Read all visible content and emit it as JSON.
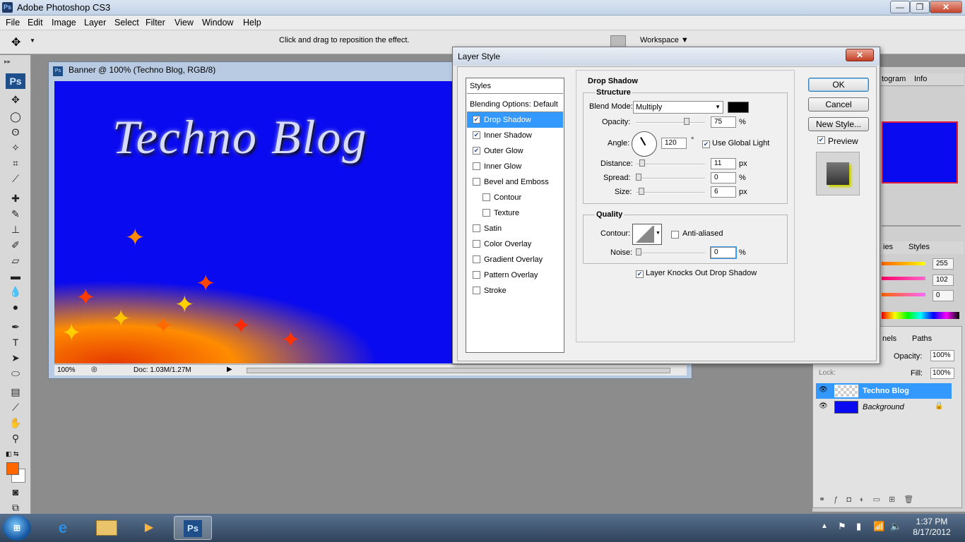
{
  "app": {
    "title": "Adobe Photoshop CS3",
    "window_controls": [
      "minimize-icon",
      "restore-icon",
      "close-icon"
    ]
  },
  "menu": [
    "File",
    "Edit",
    "Image",
    "Layer",
    "Select",
    "Filter",
    "View",
    "Window",
    "Help"
  ],
  "options_bar": {
    "hint": "Click and drag to reposition the effect.",
    "workspace": "Workspace"
  },
  "document": {
    "title": "Banner @ 100% (Techno Blog, RGB/8)",
    "canvas_text": "Techno Blog",
    "zoom": "100%",
    "doc_info": "Doc: 1.03M/1.27M",
    "canvas_color": "#0a0af0"
  },
  "dialog": {
    "title": "Layer Style",
    "styles_header": "Styles",
    "blending": "Blending Options: Default",
    "items": [
      {
        "label": "Drop Shadow",
        "checked": true,
        "selected": true
      },
      {
        "label": "Inner Shadow",
        "checked": true
      },
      {
        "label": "Outer Glow",
        "checked": true
      },
      {
        "label": "Inner Glow",
        "checked": false
      },
      {
        "label": "Bevel and Emboss",
        "checked": false
      },
      {
        "label": "Contour",
        "checked": false
      },
      {
        "label": "Texture",
        "checked": false
      },
      {
        "label": "Satin",
        "checked": false
      },
      {
        "label": "Color Overlay",
        "checked": false
      },
      {
        "label": "Gradient Overlay",
        "checked": false
      },
      {
        "label": "Pattern Overlay",
        "checked": false
      },
      {
        "label": "Stroke",
        "checked": false
      }
    ],
    "section_title": "Drop Shadow",
    "structure": {
      "title": "Structure",
      "blend_mode_label": "Blend Mode:",
      "blend_mode": "Multiply",
      "opacity_label": "Opacity:",
      "opacity": "75",
      "opacity_unit": "%",
      "opacity_frac": 0.75,
      "angle_label": "Angle:",
      "angle": "120",
      "angle_unit": "°",
      "global_light": "Use Global Light",
      "distance_label": "Distance:",
      "distance": "11",
      "distance_unit": "px",
      "distance_frac": 0.06,
      "spread_label": "Spread:",
      "spread": "0",
      "spread_unit": "%",
      "spread_frac": 0.0,
      "size_label": "Size:",
      "size": "6",
      "size_unit": "px",
      "size_frac": 0.04
    },
    "quality": {
      "title": "Quality",
      "contour_label": "Contour:",
      "anti_aliased": "Anti-aliased",
      "noise_label": "Noise:",
      "noise": "0",
      "noise_unit": "%",
      "noise_frac": 0.0
    },
    "knockout": "Layer Knocks Out Drop Shadow",
    "buttons": {
      "ok": "OK",
      "cancel": "Cancel",
      "new_style": "New Style...",
      "preview": "Preview"
    }
  },
  "panels": {
    "tabs_top": [
      "togram",
      "Info"
    ],
    "tabs_mid": [
      "ies",
      "Styles"
    ],
    "color_values": [
      "255",
      "102",
      "0"
    ],
    "tabs_layers": [
      "nels",
      "Paths"
    ],
    "opacity_label": "Opacity:",
    "opacity": "100%",
    "lock_label": "Lock:",
    "fill_label": "Fill:",
    "fill": "100%",
    "layers": [
      {
        "name": "Techno Blog",
        "selected": true
      },
      {
        "name": "Background",
        "selected": false
      }
    ]
  },
  "taskbar": {
    "time": "1:37 PM",
    "date": "8/17/2012",
    "pinned": [
      "internet-explorer-icon",
      "folder-icon",
      "media-player-icon",
      "photoshop-icon"
    ]
  },
  "colors": {
    "accent": "#3399ff",
    "foreground": "#ff6600",
    "background": "#ffffff"
  }
}
